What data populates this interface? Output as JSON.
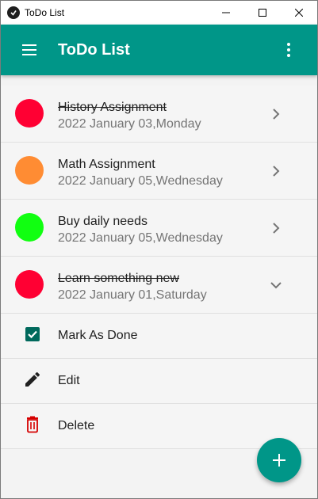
{
  "window": {
    "title": "ToDo List"
  },
  "appbar": {
    "title": "ToDo List"
  },
  "tasks": [
    {
      "title": "History Assignment",
      "date": "2022 January 03,Monday",
      "done": true,
      "color": "#ff0033"
    },
    {
      "title": "Math Assignment",
      "date": "2022 January 05,Wednesday",
      "done": false,
      "color": "#ff8c33"
    },
    {
      "title": "Buy daily needs",
      "date": "2022 January 05,Wednesday",
      "done": false,
      "color": "#11ff11"
    },
    {
      "title": "Learn something new",
      "date": "2022 January 01,Saturday",
      "done": true,
      "color": "#ff0033",
      "expanded": true
    }
  ],
  "actions": {
    "mark_done": "Mark As Done",
    "edit": "Edit",
    "delete": "Delete"
  },
  "colors": {
    "primary": "#009688",
    "delete": "#d50000",
    "check": "#00695c"
  }
}
